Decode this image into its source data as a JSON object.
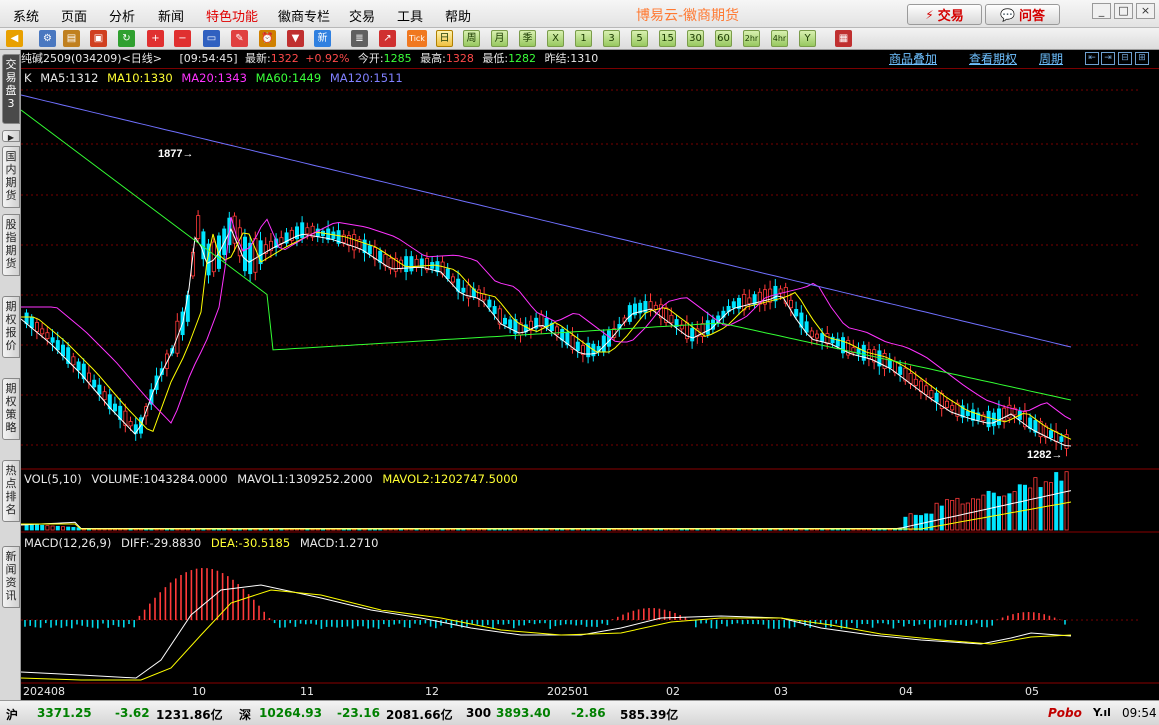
{
  "menu": [
    "系统",
    "页面",
    "分析",
    "新闻",
    "特色功能",
    "徽商专栏",
    "交易",
    "工具",
    "帮助"
  ],
  "app_title": "博易云-徽商期货",
  "buttons": {
    "trade": "交易",
    "ask": "问答"
  },
  "window_controls": [
    "_",
    "□",
    "×"
  ],
  "toolbar": {
    "icons": [
      "back-arrow-icon",
      "gear-icon",
      "database-icon",
      "folder-icon",
      "refresh-icon",
      "zoom-in-icon",
      "zoom-out-icon",
      "window-icon",
      "pen-icon",
      "alarm-icon",
      "filter-icon",
      "news-icon",
      "report-icon",
      "chart-line-icon"
    ],
    "tick_label": "Tick",
    "periods": [
      "日",
      "周",
      "月",
      "季",
      "X",
      "1",
      "3",
      "5",
      "15",
      "30",
      "60",
      "2hr",
      "4hr",
      "Y"
    ],
    "active_period": "日"
  },
  "left_tabs": [
    {
      "label": "交易盘3",
      "active": true
    },
    {
      "label": "国内期货",
      "active": false
    },
    {
      "label": "股指期货",
      "active": false
    },
    {
      "label": "期权报价",
      "active": false
    },
    {
      "label": "期权策略",
      "active": false
    },
    {
      "label": "热点排名",
      "active": false
    },
    {
      "label": "新闻资讯",
      "active": false
    }
  ],
  "quote": {
    "name": "纯碱2509",
    "code": "(034209)",
    "period": "<日线>",
    "time": "[09:54:45]",
    "latest_label": "最新:",
    "latest": "1322",
    "change": "+0.92%",
    "open_label": "今开:",
    "open": "1285",
    "high_label": "最高:",
    "high": "1328",
    "low_label": "最低:",
    "low": "1282",
    "prev_label": "昨结:",
    "prev": "1310"
  },
  "links": {
    "overlay": "商品叠加",
    "options": "查看期权",
    "period": "周期"
  },
  "ma_legend": {
    "k": "K",
    "ma5": "MA5:1312",
    "ma10": "MA10:1330",
    "ma20": "MA20:1343",
    "ma60": "MA60:1449",
    "ma120": "MA120:1511"
  },
  "annotations": {
    "high_mark": "1877",
    "low_mark": "1282"
  },
  "volume_legend": {
    "name": "VOL(5,10)",
    "volume": "VOLUME:1043284.0000",
    "mavol1": "MAVOL1:1309252.2000",
    "mavol2": "MAVOL2:1202747.5000"
  },
  "macd_legend": {
    "name": "MACD(12,26,9)",
    "diff": "DIFF:-29.8830",
    "dea": "DEA:-30.5185",
    "macd": "MACD:1.2710"
  },
  "date_labels": [
    "202408",
    "10",
    "11",
    "12",
    "202501",
    "02",
    "03",
    "04",
    "05"
  ],
  "status": {
    "sh_label": "沪",
    "sh_index": "3371.25",
    "sh_change": "-3.62",
    "sh_amount": "1231.86亿",
    "sz_label": "深",
    "sz_index": "10264.93",
    "sz_change": "-23.16",
    "sz_amount": "2081.66亿",
    "hs_label": "300",
    "hs_index": "3893.40",
    "hs_change": "-2.86",
    "hs_amount": "585.39亿",
    "brand": "Pobo",
    "clock": "09:54"
  },
  "colors": {
    "up": "#ff3a3a",
    "down": "#00e5ff",
    "ma5": "#ffffff",
    "ma10": "#ffff00",
    "ma20": "#ff33ff",
    "ma60": "#33ff33",
    "ma120": "#7070ff"
  }
}
